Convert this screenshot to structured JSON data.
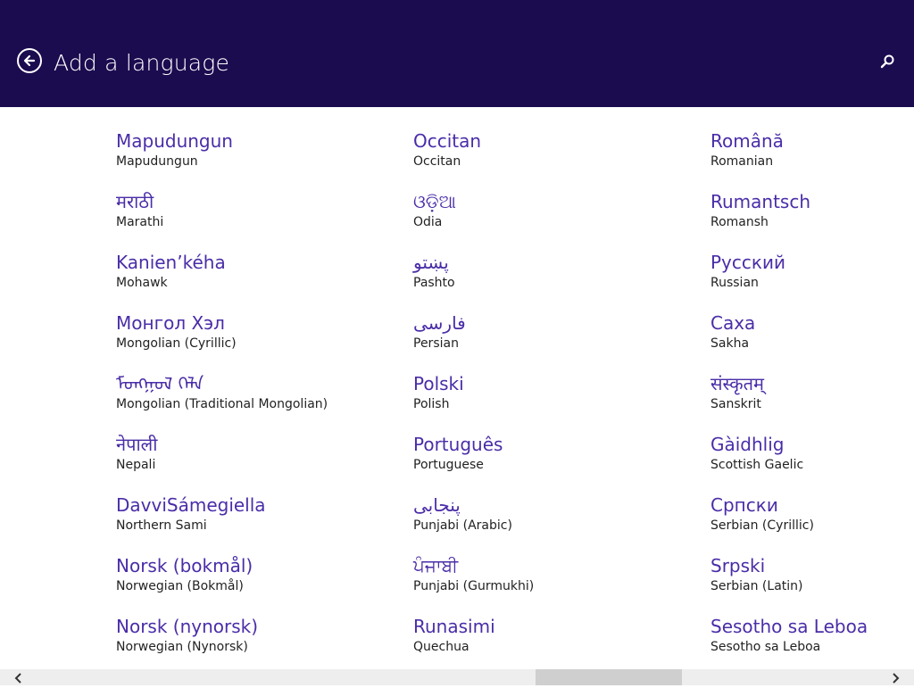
{
  "header": {
    "title": "Add a language",
    "back_icon": "back-arrow-icon",
    "search_icon": "search-icon",
    "background": "#1b0b4f"
  },
  "colors": {
    "accent": "#4a2da8",
    "text": "#222222"
  },
  "columns": [
    {
      "items": [
        {
          "native": "Mapudungun",
          "english": "Mapudungun"
        },
        {
          "native": "मराठी",
          "english": "Marathi"
        },
        {
          "native": "Kanien’kéha",
          "english": "Mohawk"
        },
        {
          "native": "Монгол Хэл",
          "english": "Mongolian (Cyrillic)"
        },
        {
          "native": "ᠮᠣᠩᠭᠣᠯ ᠬᠡᠯᠡ",
          "english": "Mongolian (Traditional Mongolian)"
        },
        {
          "native": "नेपाली",
          "english": "Nepali"
        },
        {
          "native": "DavviSámegiella",
          "english": "Northern Sami"
        },
        {
          "native": "Norsk (bokmål)",
          "english": "Norwegian (Bokmål)"
        },
        {
          "native": "Norsk (nynorsk)",
          "english": "Norwegian (Nynorsk)"
        }
      ]
    },
    {
      "items": [
        {
          "native": "Occitan",
          "english": "Occitan"
        },
        {
          "native": "ଓଡ଼ିଆ",
          "english": "Odia"
        },
        {
          "native": "پښتو",
          "english": "Pashto"
        },
        {
          "native": "فارسی",
          "english": "Persian"
        },
        {
          "native": "Polski",
          "english": "Polish"
        },
        {
          "native": "Português",
          "english": "Portuguese"
        },
        {
          "native": "پنجابی",
          "english": "Punjabi (Arabic)"
        },
        {
          "native": "ਪੰਜਾਬੀ",
          "english": "Punjabi (Gurmukhi)"
        },
        {
          "native": "Runasimi",
          "english": "Quechua"
        }
      ]
    },
    {
      "items": [
        {
          "native": "Română",
          "english": "Romanian"
        },
        {
          "native": "Rumantsch",
          "english": "Romansh"
        },
        {
          "native": "Русский",
          "english": "Russian"
        },
        {
          "native": "Саха",
          "english": "Sakha"
        },
        {
          "native": "संस्कृतम्",
          "english": "Sanskrit"
        },
        {
          "native": "Gàidhlig",
          "english": "Scottish Gaelic"
        },
        {
          "native": "Српски",
          "english": "Serbian (Cyrillic)"
        },
        {
          "native": "Srpski",
          "english": "Serbian (Latin)"
        },
        {
          "native": "Sesotho sa Leboa",
          "english": "Sesotho sa Leboa"
        }
      ]
    }
  ],
  "scrollbar": {
    "left_icon": "chevron-left-icon",
    "right_icon": "chevron-right-icon"
  }
}
